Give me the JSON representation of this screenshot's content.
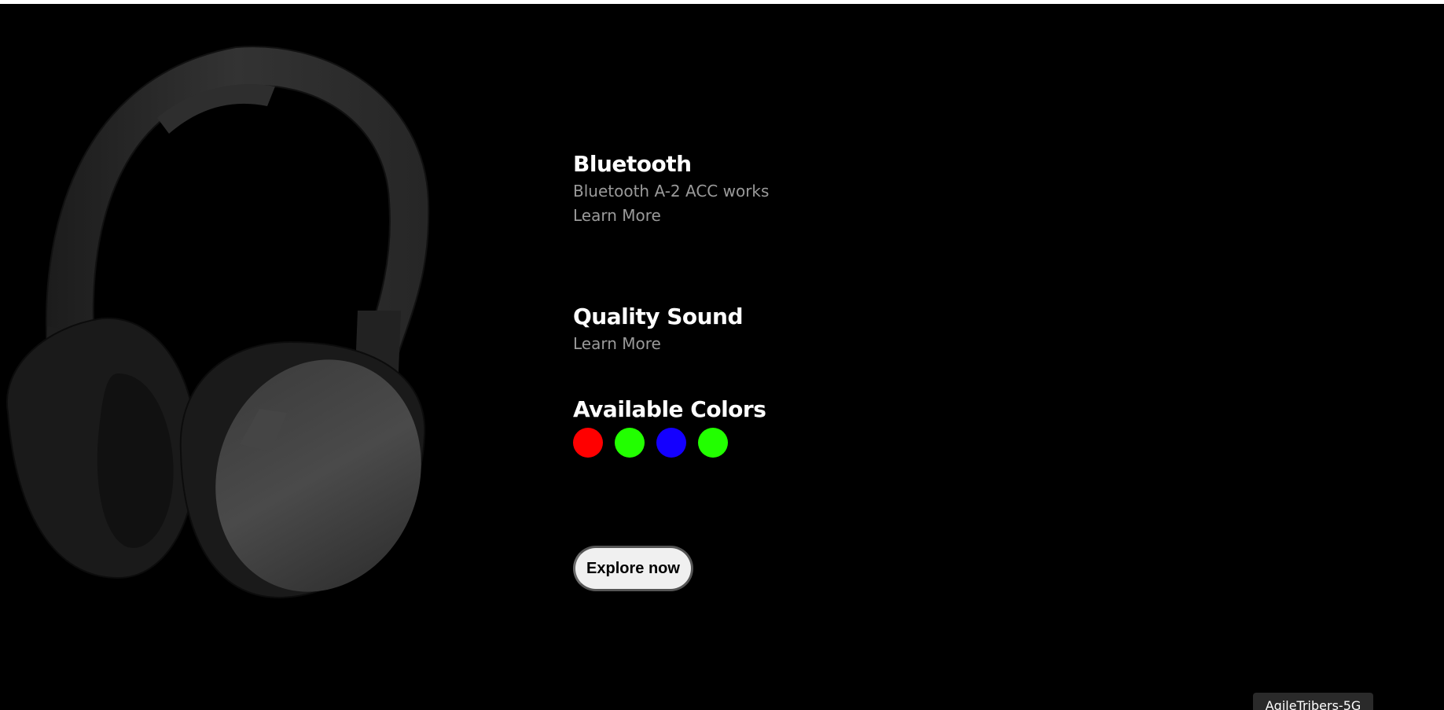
{
  "features": {
    "bluetooth": {
      "title": "Bluetooth",
      "description": "Bluetooth A-2 ACC works",
      "link": "Learn More"
    },
    "sound": {
      "title": "Quality Sound",
      "link": "Learn More"
    }
  },
  "colors": {
    "title": "Available Colors",
    "swatches": [
      {
        "name": "red",
        "hex": "#ff0000"
      },
      {
        "name": "green",
        "hex": "#22ff00"
      },
      {
        "name": "blue",
        "hex": "#1400ff"
      },
      {
        "name": "green",
        "hex": "#22ff00"
      }
    ]
  },
  "cta": {
    "label": "Explore now"
  },
  "footer": {
    "tag": "AgileTribers-5G"
  },
  "hero": {
    "icon": "headphones-image"
  }
}
